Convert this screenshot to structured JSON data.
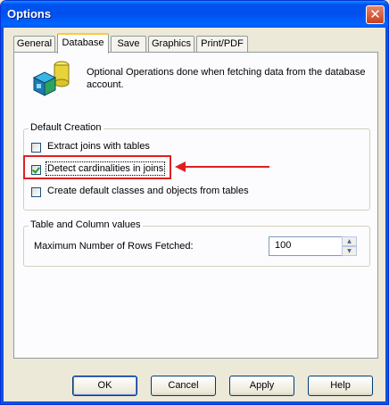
{
  "window": {
    "title": "Options",
    "close_glyph": "✕"
  },
  "tabs": [
    {
      "label": "General",
      "active": false
    },
    {
      "label": "Database",
      "active": true
    },
    {
      "label": "Save",
      "active": false
    },
    {
      "label": "Graphics",
      "active": false
    },
    {
      "label": "Print/PDF",
      "active": false
    }
  ],
  "panel": {
    "icon": "database-icon",
    "description": "Optional Operations done when fetching data from the database account."
  },
  "default_creation": {
    "legend": "Default Creation",
    "options": [
      {
        "label": "Extract joins with tables",
        "checked": false
      },
      {
        "label": "Detect cardinalities in joins",
        "checked": true
      },
      {
        "label": "Create default classes and objects from tables",
        "checked": false
      }
    ]
  },
  "table_column": {
    "legend": "Table and Column values",
    "rows_label": "Maximum Number of Rows Fetched:",
    "rows_value": "100"
  },
  "buttons": {
    "ok": "OK",
    "cancel": "Cancel",
    "apply": "Apply",
    "help": "Help"
  },
  "colors": {
    "annotation": "#e02020",
    "title_bar": "#0054e3"
  }
}
